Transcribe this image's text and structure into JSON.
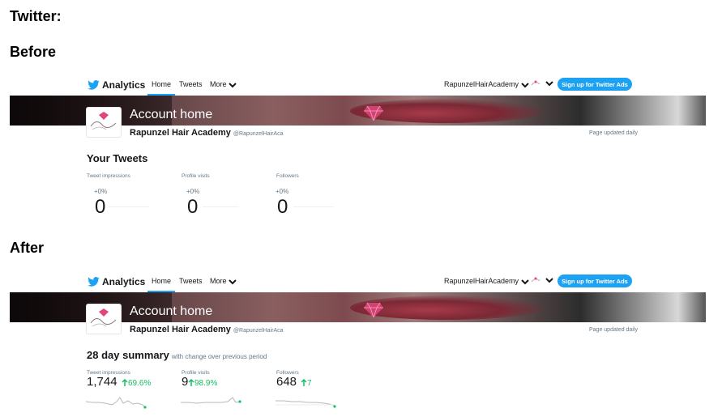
{
  "slide": {
    "title": "Twitter:",
    "before_label": "Before",
    "after_label": "After"
  },
  "nav": {
    "brand": "Analytics",
    "home": "Home",
    "tweets": "Tweets",
    "more": "More",
    "account": "RapunzelHairAcademy",
    "ads_button": "Sign up for Twitter Ads"
  },
  "profile": {
    "page_title": "Account home",
    "name": "Rapunzel Hair Academy",
    "handle": "@RapunzelHairAca",
    "updated": "Page updated daily"
  },
  "before": {
    "section_title": "Your Tweets",
    "metrics": [
      {
        "label": "Tweet impressions",
        "change": "+0%",
        "value": "0"
      },
      {
        "label": "Profile visits",
        "change": "+0%",
        "value": "0"
      },
      {
        "label": "Followers",
        "change": "+0%",
        "value": "0"
      }
    ]
  },
  "after": {
    "section_title": "28 day summary",
    "section_subtitle": "with change over previous period",
    "metrics": [
      {
        "label": "Tweet impressions",
        "value": "1,744",
        "change": "69.6%"
      },
      {
        "label": "Profile visits",
        "value": "9",
        "change": "98.9%"
      },
      {
        "label": "Followers",
        "value": "648",
        "change": "7"
      }
    ]
  },
  "colors": {
    "accent_blue": "#1da1f2",
    "positive_green": "#17bf63",
    "muted_text": "#657786"
  }
}
